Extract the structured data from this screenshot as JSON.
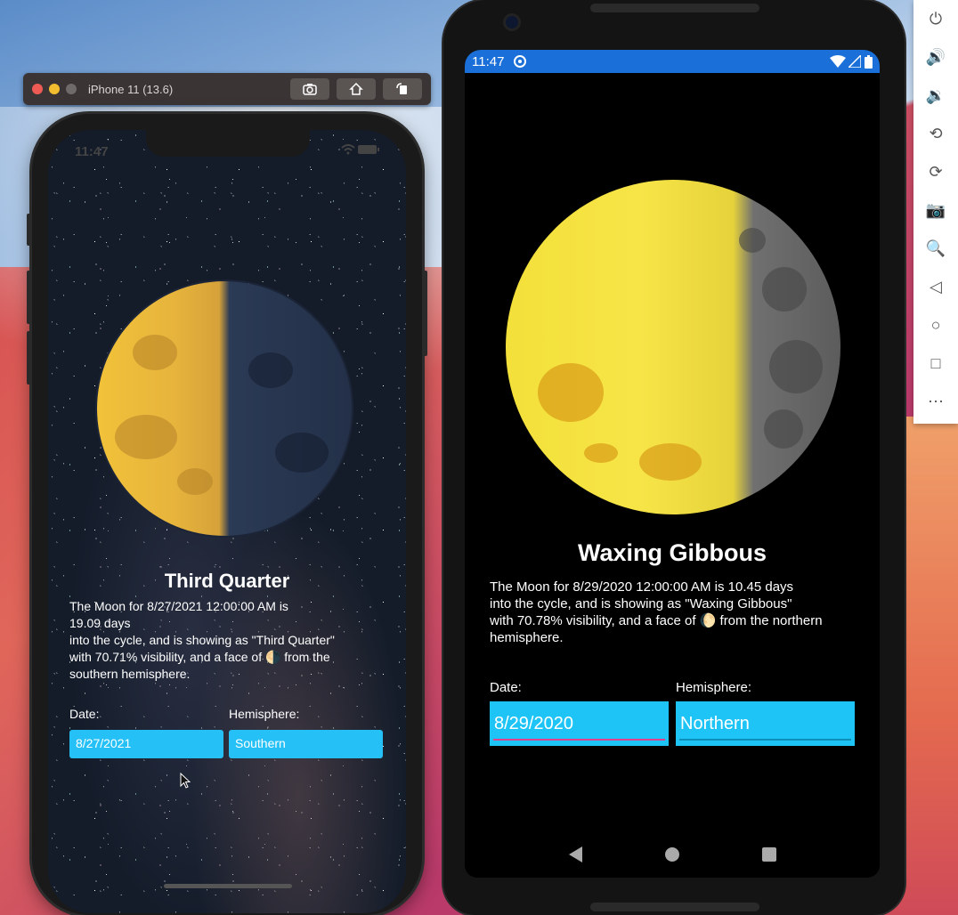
{
  "simulator": {
    "title": "iPhone 11 (13.6)",
    "buttons": {
      "screenshot": "screenshot-icon",
      "home": "home-icon",
      "rotate": "rotate-icon"
    }
  },
  "ios_app": {
    "time": "11:47",
    "phase": "Third Quarter",
    "description_lines": [
      "The Moon for 8/27/2021 12:00:00 AM is",
      "19.09 days",
      "into the cycle, and is showing as \"Third Quarter\"",
      "with 70.71% visibility, and a face of 🌗 from the",
      "southern hemisphere."
    ],
    "date_label": "Date:",
    "hemisphere_label": "Hemisphere:",
    "date_value": "8/27/2021",
    "hemisphere_value": "Southern"
  },
  "android_app": {
    "time": "11:47",
    "phase": "Waxing Gibbous",
    "description_lines": [
      "The Moon for 8/29/2020 12:00:00 AM is 10.45 days",
      "into the cycle, and is showing as \"Waxing Gibbous\"",
      "with 70.78% visibility, and a face of 🌔 from the northern",
      "hemisphere."
    ],
    "date_label": "Date:",
    "hemisphere_label": "Hemisphere:",
    "date_value": "8/29/2020",
    "hemisphere_value": "Northern"
  },
  "emulator_toolbar": {
    "glyphs": {
      "power": "⏻",
      "volume_up": "🔊",
      "volume_down": "🔉",
      "rotate_left": "⟲",
      "rotate_right": "⟳",
      "camera": "📷",
      "zoom": "🔍",
      "back": "◁",
      "home": "○",
      "overview": "□",
      "more": "⋯"
    }
  },
  "colors": {
    "ios_field": "#25c0f5",
    "android_field": "#1ec4f5",
    "android_status": "#1a6fd8",
    "android_underline_active": "#e0418a"
  }
}
